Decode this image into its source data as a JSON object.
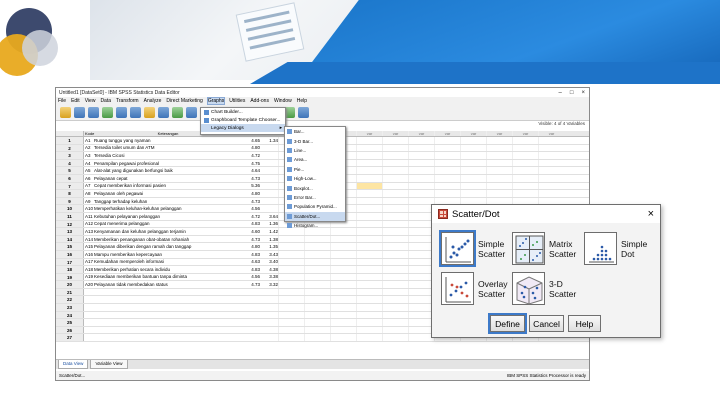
{
  "window": {
    "title": "Untitled1 [DataSet0] - IBM SPSS Statistics Data Editor",
    "controls": [
      "–",
      "□",
      "×"
    ]
  },
  "menubar": [
    "File",
    "Edit",
    "View",
    "Data",
    "Transform",
    "Analyze",
    "Direct Marketing",
    "Graphs",
    "Utilities",
    "Add-ons",
    "Window",
    "Help"
  ],
  "visible_label": "Visible: 4 of 4 Variables",
  "columns": [
    "Kode",
    "Keterangan",
    "",
    "",
    "var",
    "var",
    "var",
    "var",
    "var",
    "var",
    "var",
    "var",
    "var",
    "var",
    "var"
  ],
  "rows": [
    {
      "n": "1",
      "k": "A1",
      "t": "Ruang tunggu yang nyaman",
      "a": "4.65",
      "b": "1.34"
    },
    {
      "n": "2",
      "k": "A2",
      "t": "Tersedia toilet umum dan ATM",
      "a": "4.80",
      "b": ""
    },
    {
      "n": "3",
      "k": "A3",
      "t": "Tersedia Cicosi",
      "a": "4.72",
      "b": ""
    },
    {
      "n": "4",
      "k": "A4",
      "t": "Penampilan pegawai profesional",
      "a": "4.75",
      "b": ""
    },
    {
      "n": "5",
      "k": "A5",
      "t": "Alat-alat yang digunakan berfungsi baik",
      "a": "4.64",
      "b": ""
    },
    {
      "n": "6",
      "k": "A6",
      "t": "Pelayanan cepat",
      "a": "4.73",
      "b": ""
    },
    {
      "n": "7",
      "k": "A7",
      "t": "Cepat memberikan informasi pasien",
      "a": "5.36",
      "b": ""
    },
    {
      "n": "8",
      "k": "A8",
      "t": "Pelayanan oleh pegawai",
      "a": "4.80",
      "b": ""
    },
    {
      "n": "9",
      "k": "A9",
      "t": "Tanggap terhadap keluhan",
      "a": "4.73",
      "b": ""
    },
    {
      "n": "10",
      "k": "A10",
      "t": "Memperhatikan keluhan-keluhan pelanggan",
      "a": "4.56",
      "b": ""
    },
    {
      "n": "11",
      "k": "A11",
      "t": "Kebutuhan pelayanan pelanggan",
      "a": "4.72",
      "b": "3.64"
    },
    {
      "n": "12",
      "k": "A12",
      "t": "Cepat menerima pelanggan",
      "a": "4.83",
      "b": "1.36"
    },
    {
      "n": "13",
      "k": "A13",
      "t": "Kenyamanan dan keluhan pelanggan terjamin",
      "a": "4.60",
      "b": "1.42"
    },
    {
      "n": "14",
      "k": "A14",
      "t": "Memberikan penanganan obat-obatan rohaniah",
      "a": "4.73",
      "b": "1.38"
    },
    {
      "n": "15",
      "k": "A15",
      "t": "Pelayanan diberikan dengan ramah dan tanggap",
      "a": "4.80",
      "b": "1.35"
    },
    {
      "n": "16",
      "k": "A16",
      "t": "Mampu memberikan kepercayaan",
      "a": "4.83",
      "b": "3.43"
    },
    {
      "n": "17",
      "k": "A17",
      "t": "Kemudahan memperoleh informasi",
      "a": "4.63",
      "b": "3.40"
    },
    {
      "n": "18",
      "k": "A18",
      "t": "Memberikan perhatian secara individu",
      "a": "4.83",
      "b": "4.38"
    },
    {
      "n": "19",
      "k": "A19",
      "t": "Kesediaan memberikan bantuan tanpa diminta",
      "a": "4.56",
      "b": "3.38"
    },
    {
      "n": "20",
      "k": "A20",
      "t": "Pelayanan tidak membedakan status",
      "a": "4.73",
      "b": "3.32"
    },
    {
      "n": "21",
      "k": "",
      "t": "",
      "a": "",
      "b": ""
    },
    {
      "n": "22",
      "k": "",
      "t": "",
      "a": "",
      "b": ""
    },
    {
      "n": "23",
      "k": "",
      "t": "",
      "a": "",
      "b": ""
    },
    {
      "n": "24",
      "k": "",
      "t": "",
      "a": "",
      "b": ""
    },
    {
      "n": "25",
      "k": "",
      "t": "",
      "a": "",
      "b": ""
    },
    {
      "n": "26",
      "k": "",
      "t": "",
      "a": "",
      "b": ""
    },
    {
      "n": "27",
      "k": "",
      "t": "",
      "a": "",
      "b": ""
    }
  ],
  "graphs_menu": [
    "Chart Builder...",
    "Graphboard Template Chooser...",
    "Legacy Dialogs"
  ],
  "legacy_menu": [
    "Bar...",
    "3-D Bar...",
    "Line...",
    "Area...",
    "Pie...",
    "High-Low...",
    "Boxplot...",
    "Error Bar...",
    "Population Pyramid...",
    "Scatter/Dot...",
    "Histogram..."
  ],
  "tabs": {
    "data": "Data View",
    "variable": "Variable View"
  },
  "status": {
    "left": "Scatter/Dot...",
    "right": "IBM SPSS Statistics Processor is ready"
  },
  "dialog": {
    "title": "Scatter/Dot",
    "close": "×",
    "options": [
      {
        "label1": "Simple",
        "label2": "Scatter"
      },
      {
        "label1": "Matrix",
        "label2": "Scatter"
      },
      {
        "label1": "Simple",
        "label2": "Dot"
      },
      {
        "label1": "Overlay",
        "label2": "Scatter"
      },
      {
        "label1": "3-D",
        "label2": "Scatter"
      }
    ],
    "buttons": {
      "define": "Define",
      "cancel": "Cancel",
      "help": "Help"
    }
  }
}
